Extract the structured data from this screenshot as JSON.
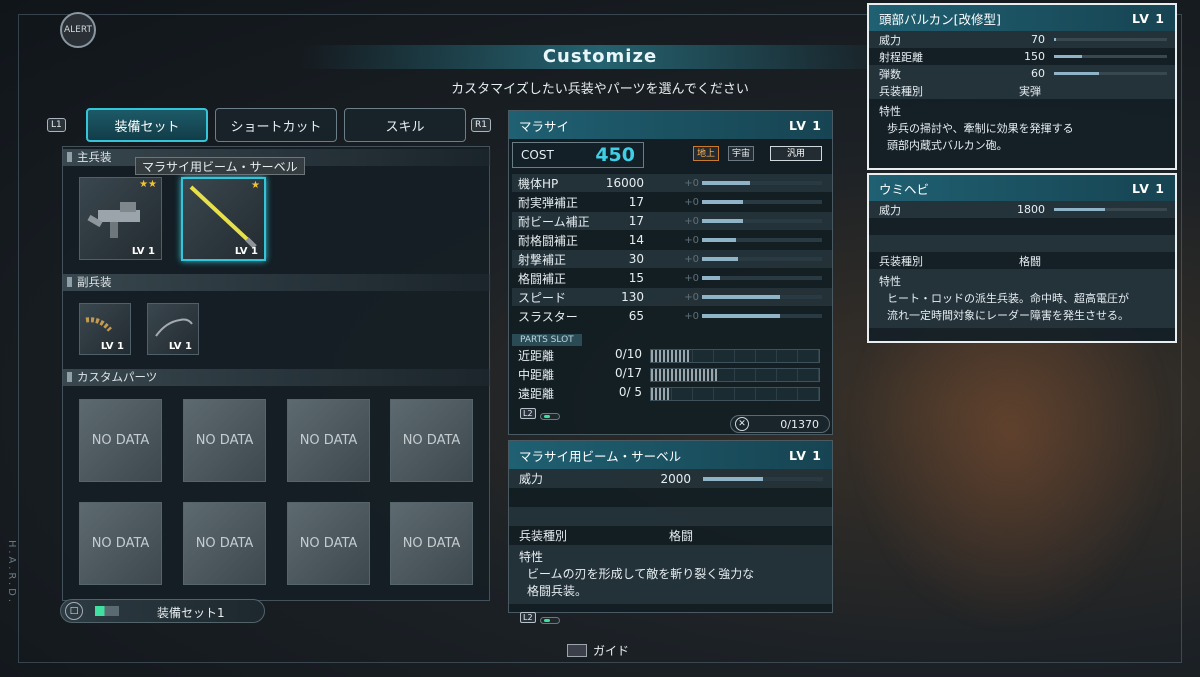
{
  "alert": "ALERT",
  "title": "Customize",
  "subtitle": "カスタマイズしたい兵装やパーツを選んでください",
  "hard_label": "H.A.R.D.",
  "tabs": {
    "l1": "L1",
    "r1": "R1",
    "items": [
      "装備セット",
      "ショートカット",
      "スキル"
    ]
  },
  "main_weapon": {
    "header": "主兵装",
    "tooltip": "マラサイ用ビーム・サーベル",
    "items": [
      {
        "lv": "LV 1",
        "stars": "★★"
      },
      {
        "lv": "LV 1",
        "stars": "★"
      }
    ]
  },
  "sub_weapon": {
    "header": "副兵装",
    "items": [
      {
        "lv": "LV 1"
      },
      {
        "lv": "LV 1"
      }
    ]
  },
  "custom_parts": {
    "header": "カスタムパーツ",
    "slot_label": "NO DATA"
  },
  "loadout": {
    "label": "装備セット1"
  },
  "unit": {
    "name": "マラサイ",
    "lv": "LV 1",
    "cost_label": "COST",
    "cost": "450",
    "env": [
      "地上",
      "宇宙",
      "汎用"
    ],
    "stats": [
      {
        "name": "機体HP",
        "value": "16000",
        "mod": "+0",
        "fill": 0.4
      },
      {
        "name": "耐実弾補正",
        "value": "17",
        "mod": "+0",
        "fill": 0.34
      },
      {
        "name": "耐ビーム補正",
        "value": "17",
        "mod": "+0",
        "fill": 0.34
      },
      {
        "name": "耐格闘補正",
        "value": "14",
        "mod": "+0",
        "fill": 0.28
      },
      {
        "name": "射撃補正",
        "value": "30",
        "mod": "+0",
        "fill": 0.3
      },
      {
        "name": "格闘補正",
        "value": "15",
        "mod": "+0",
        "fill": 0.15
      },
      {
        "name": "スピード",
        "value": "130",
        "mod": "+0",
        "fill": 0.65
      },
      {
        "name": "スラスター",
        "value": "65",
        "mod": "+0",
        "fill": 0.65
      }
    ],
    "parts_slot_label": "PARTS SLOT",
    "parts": [
      {
        "name": "近距離",
        "value": "0/10",
        "fill": 0.24
      },
      {
        "name": "中距離",
        "value": "0/17",
        "fill": 0.4
      },
      {
        "name": "遠距離",
        "value": "0/ 5",
        "fill": 0.12
      }
    ],
    "counter": "0/1370",
    "l2": "L2"
  },
  "weapon_panel": {
    "name": "マラサイ用ビーム・サーベル",
    "lv": "LV 1",
    "power_label": "威力",
    "power": "2000",
    "power_fill": 0.5,
    "type_label": "兵装種別",
    "type": "格闘",
    "trait_label": "特性",
    "trait_lines": [
      "ビームの刃を形成して敵を斬り裂く強力な",
      "格闘兵装。"
    ],
    "l2": "L2"
  },
  "vulcan_panel": {
    "name": "頭部バルカン[改修型]",
    "lv": "LV 1",
    "stats": [
      {
        "name": "威力",
        "value": "70",
        "fill": 0.02
      },
      {
        "name": "射程距離",
        "value": "150",
        "fill": 0.25
      },
      {
        "name": "弾数",
        "value": "60",
        "fill": 0.4
      }
    ],
    "type_label": "兵装種別",
    "type": "実弾",
    "trait_label": "特性",
    "trait_lines": [
      "歩兵の掃討や、牽制に効果を発揮する",
      "頭部内蔵式バルカン砲。"
    ]
  },
  "umihebi_panel": {
    "name": "ウミヘビ",
    "lv": "LV 1",
    "power_label": "威力",
    "power": "1800",
    "power_fill": 0.45,
    "type_label": "兵装種別",
    "type": "格闘",
    "trait_label": "特性",
    "trait_lines": [
      "ヒート・ロッドの派生兵装。命中時、超高電圧が",
      "流れ一定時間対象にレーダー障害を発生させる。"
    ]
  },
  "guide": "ガイド",
  "colors": {
    "accent": "#35c4d8",
    "cost": "#3fd0e6",
    "header": "#1f6072"
  }
}
